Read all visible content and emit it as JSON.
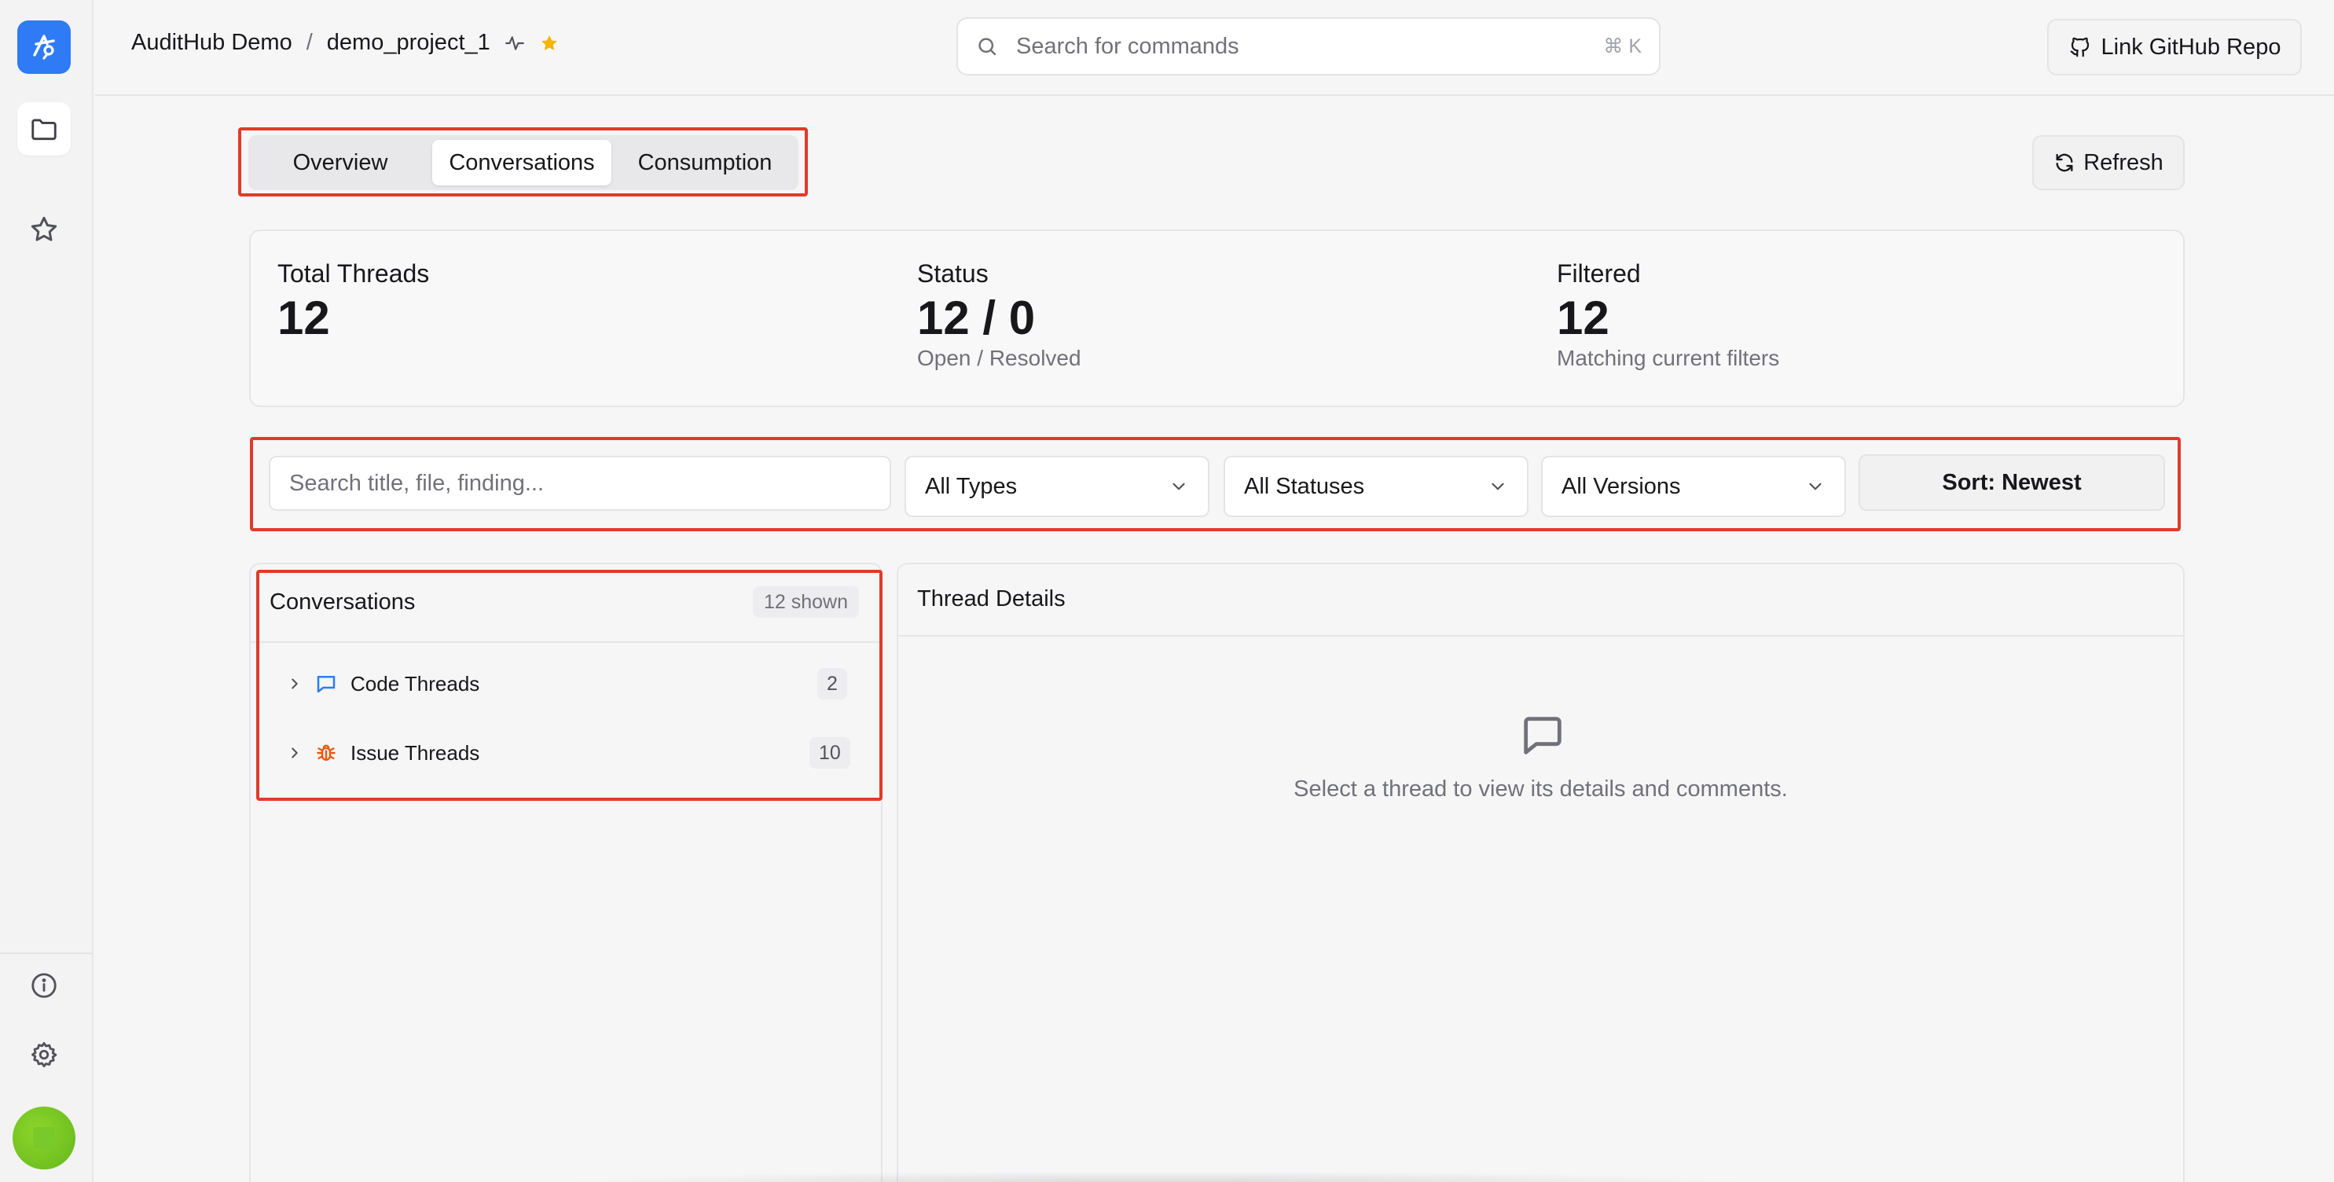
{
  "breadcrumb": {
    "org": "AuditHub Demo",
    "separator": "/",
    "project": "demo_project_1"
  },
  "search": {
    "placeholder": "Search for commands",
    "shortcut": "⌘ K"
  },
  "header": {
    "github_label": "Link GitHub Repo"
  },
  "tabs": [
    {
      "label": "Overview",
      "active": false
    },
    {
      "label": "Conversations",
      "active": true
    },
    {
      "label": "Consumption",
      "active": false
    }
  ],
  "refresh_label": "Refresh",
  "stats": {
    "total": {
      "label": "Total Threads",
      "value": "12"
    },
    "status": {
      "label": "Status",
      "value": "12 / 0",
      "sub": "Open / Resolved"
    },
    "filtered": {
      "label": "Filtered",
      "value": "12",
      "sub": "Matching current filters"
    }
  },
  "filters": {
    "search_placeholder": "Search title, file, finding...",
    "types": "All Types",
    "statuses": "All Statuses",
    "versions": "All Versions",
    "sort": "Sort: Newest"
  },
  "conversations": {
    "title": "Conversations",
    "count_label": "12 shown",
    "groups": [
      {
        "label": "Code Threads",
        "count": "2",
        "icon": "message-icon"
      },
      {
        "label": "Issue Threads",
        "count": "10",
        "icon": "bug-icon"
      }
    ]
  },
  "details": {
    "title": "Thread Details",
    "empty_message": "Select a thread to view its details and comments."
  },
  "colors": {
    "accent": "#2f7bf5",
    "star": "#f5b400",
    "highlight_outline": "#e23a2a",
    "bug": "#ea580c",
    "avatar": "#6cc21f"
  }
}
